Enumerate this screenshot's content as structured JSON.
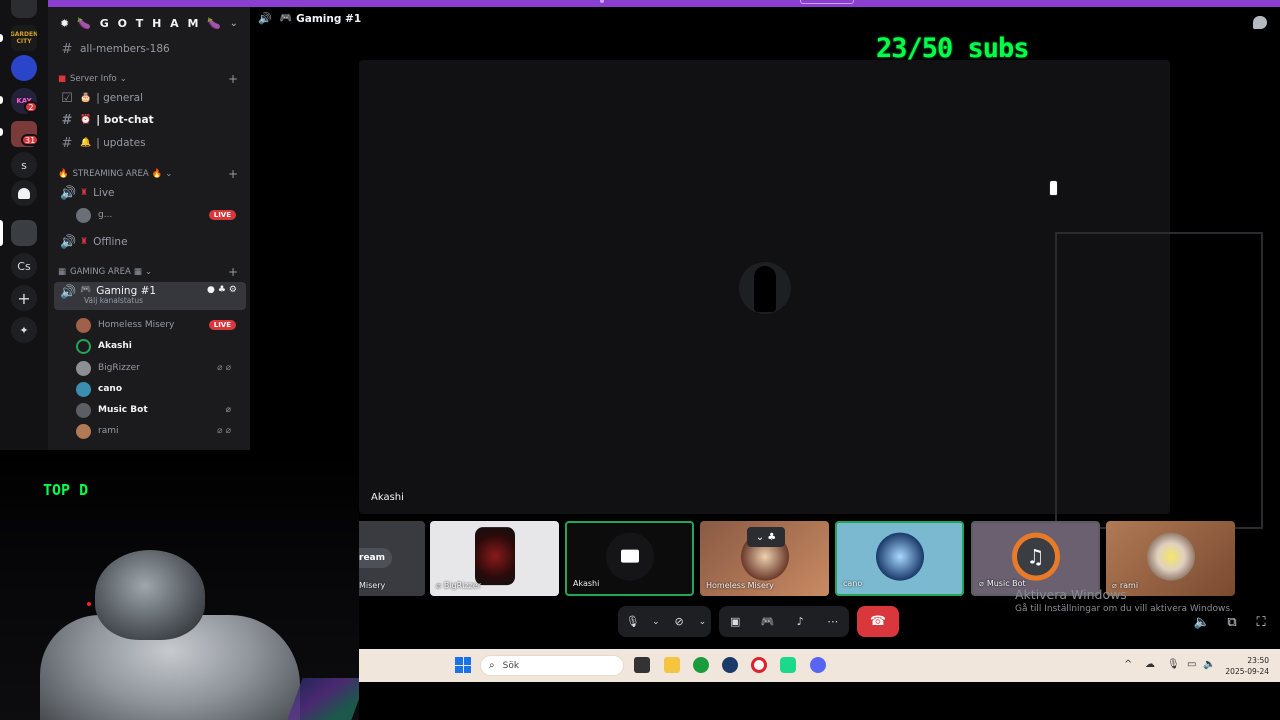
{
  "server": {
    "name": "🍆 G O T H A M 🍆",
    "rail_labels": [
      "s",
      "Cs"
    ],
    "rail_badges": [
      "2",
      "31"
    ],
    "rail_logo": "GARDEN CITY"
  },
  "channels": {
    "top_channel": "all-members-186",
    "category_server_info": "Server Info",
    "general": "| general",
    "bot_chat": "| bot-chat",
    "updates": "| updates",
    "category_streaming": "STREAMING AREA",
    "live_channel": "Live",
    "live_user": "g...",
    "offline_channel": "Offline",
    "category_gaming": "GAMING AREA",
    "gaming_channel": "Gaming #1",
    "gaming_status": "Välj kanalstatus"
  },
  "voice_members": [
    {
      "name": "Homeless Misery",
      "live": "LIVE",
      "color": "#a0614a"
    },
    {
      "name": "Akashi",
      "color": "#1b1b1e"
    },
    {
      "name": "BigRizzer",
      "color": "#8d8f93"
    },
    {
      "name": "cano",
      "color": "#3a8fb0"
    },
    {
      "name": "Music Bot",
      "color": "#5b5e63"
    },
    {
      "name": "rami",
      "color": "#b07a55"
    }
  ],
  "live_badge": "LIVE",
  "webcam": {
    "overlay_text": "TOP D"
  },
  "voice_panel": {
    "channel_name": "Gaming #1",
    "subs_counter": "23/50 subs",
    "focused_user": "Akashi"
  },
  "tiles": [
    {
      "name": "Misery",
      "extra": "ream"
    },
    {
      "name": "BigRizzer"
    },
    {
      "name": "Akashi"
    },
    {
      "name": "Homeless Misery"
    },
    {
      "name": "cano"
    },
    {
      "name": "Music Bot"
    },
    {
      "name": "rami"
    }
  ],
  "windows_notice": {
    "line1": "Aktivera Windows",
    "line2": "Gå till Inställningar om du vill aktivera Windows."
  },
  "taskbar": {
    "search_placeholder": "Sök",
    "time": "23:50",
    "date": "2025-09-24"
  },
  "colors": {
    "accent_green": "#00ff4c",
    "live_red": "#da373c",
    "top_purple": "#8a3fd1"
  }
}
